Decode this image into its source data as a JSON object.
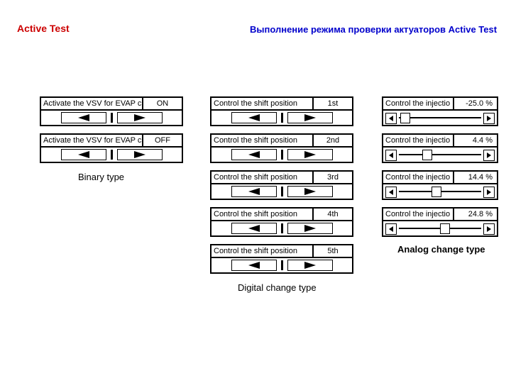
{
  "titles": {
    "left": "Active Test",
    "right": "Выполнение режима проверки актуаторов Active Test"
  },
  "sections": {
    "binary": "Binary type",
    "digital": "Digital change type",
    "analog": "Analog change type"
  },
  "binary": [
    {
      "label": "Activate the VSV for EVAP c",
      "value": "ON"
    },
    {
      "label": "Activate the VSV for EVAP c",
      "value": "OFF"
    }
  ],
  "digital": [
    {
      "label": "Control the shift position",
      "value": "1st"
    },
    {
      "label": "Control the shift position",
      "value": "2nd"
    },
    {
      "label": "Control the shift position",
      "value": "3rd"
    },
    {
      "label": "Control the shift position",
      "value": "4th"
    },
    {
      "label": "Control the shift position",
      "value": "5th"
    }
  ],
  "analog": [
    {
      "label": "Control the injectio",
      "value": "-25.0 %",
      "pos": 4
    },
    {
      "label": "Control the injectio",
      "value": "4.4 %",
      "pos": 30
    },
    {
      "label": "Control the injectio",
      "value": "14.4 %",
      "pos": 42
    },
    {
      "label": "Control the injectio",
      "value": "24.8 %",
      "pos": 54
    }
  ]
}
